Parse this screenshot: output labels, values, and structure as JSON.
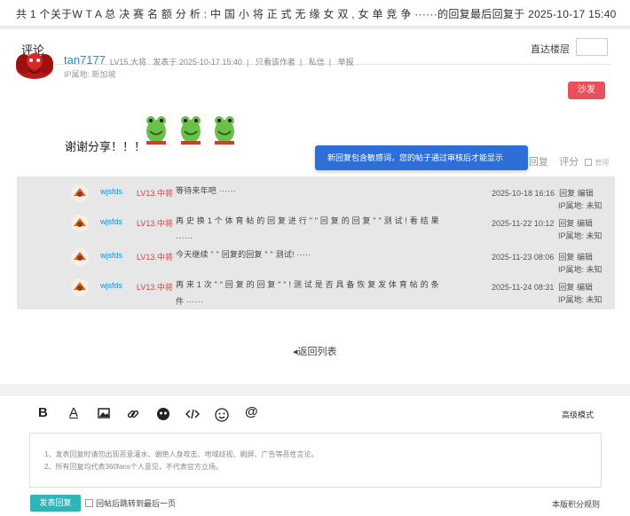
{
  "topbar": {
    "text": "共 1 个关于W T A 总 决 赛 名 额 分 析 : 中 国 小 将 正 式 无 缘 女 双 , 女 单 竞 争 ······的回复最后回复于 2025-10-17 15:40"
  },
  "comments_header": {
    "title": "评论",
    "jump_label": "直达楼层",
    "jump_value": ""
  },
  "post": {
    "username": "tan7177",
    "level": "LV15.大将",
    "posted": "发表于 2025-10-17 15:40",
    "only_author": "只看该作者",
    "pm": "私信",
    "report": "举报",
    "sep": "|",
    "ip": "IP属地: 新加坡",
    "sofa": "沙发",
    "content": "谢谢分享！！！",
    "emoji_icon": "green-frog-emoji-icon"
  },
  "tooltip": "新回复包含敏感词，您的帖子通过审核后才能显示",
  "actions": {
    "reply": "回复",
    "rate": "评分",
    "manage": "管理"
  },
  "sub_replies": [
    {
      "user": "wjsfds",
      "level": "LV13.中将",
      "text": "等待来年吧 ······",
      "time": "2025-10-18 16:16",
      "reply": "回复",
      "edit": "编辑",
      "ip": "IP属地: 未知"
    },
    {
      "user": "wjsfds",
      "level": "LV13.中将",
      "text": "再 史 换 1 个 体 育 帖 的 回 复 进 行 \" \" 回 复 的 回 复 \" \" 测 试 ! 看 结 果 ······",
      "time": "2025-11-22 10:12",
      "reply": "回复",
      "edit": "编辑",
      "ip": "IP属地: 未知"
    },
    {
      "user": "wjsfds",
      "level": "LV13.中将",
      "text": "今天继续 \" \" 回复的回复 \" \" 测试! ·····",
      "time": "2025-11-23 08:06",
      "reply": "回复",
      "edit": "编辑",
      "ip": "IP属地: 未知"
    },
    {
      "user": "wjsfds",
      "level": "LV13.中将",
      "text": "再 来 1 次 \" \" 回 复 的 回 复 \" \" ! 测 试 是 否 具 备 恢 复 发 体 育 帖 的 条 件 ······",
      "time": "2025-11-24 08:31",
      "reply": "回复",
      "edit": "编辑",
      "ip": "IP属地: 未知"
    }
  ],
  "back_link": "返回列表",
  "editor": {
    "bold": "B",
    "underline": "A",
    "at": "@",
    "advanced": "高级模式",
    "placeholder_line1": "1、发表回复时请勿出现恶意灌水、谢绝人身攻击、地域歧视、刷屏、广告等恶性言论。",
    "placeholder_line2": "2、所有回复均代表360fans个人意见，不代表官方立场。",
    "submit": "发表回复",
    "jump_after": "回帖后跳转到最后一页",
    "rules": "本版积分规则"
  }
}
